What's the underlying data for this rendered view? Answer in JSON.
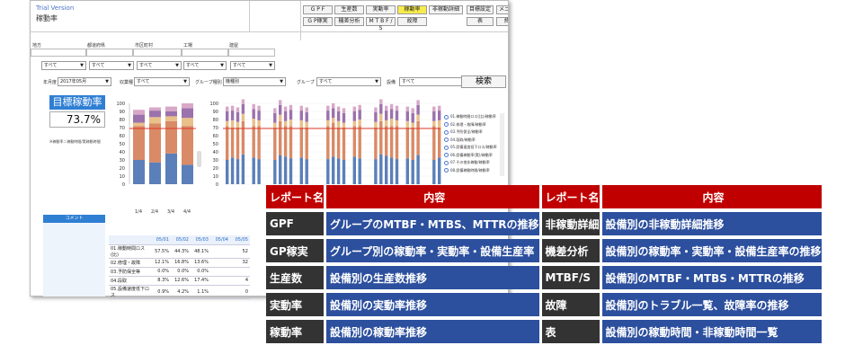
{
  "app": {
    "trial": "Trial Version",
    "title": "稼動率",
    "toolbar": {
      "row1": [
        "G P F",
        "生産数",
        "実動率",
        "稼動率",
        "非稼動詳細",
        "目標設定",
        "メニュー"
      ],
      "row2": [
        "G P稼実",
        "機差分析",
        "M T B F / S",
        "故障",
        "表",
        "終了"
      ],
      "active": "稼動率"
    },
    "filters": {
      "labels": [
        "地方",
        "都道府県",
        "市区町村",
        "工場",
        "建屋"
      ],
      "selects": [
        "すべて",
        "すべて",
        "すべて",
        "すべて",
        "すべて"
      ]
    },
    "subfilters": {
      "period_label": "年月度",
      "period_value": "2017年05月",
      "industry_label": "収業種",
      "industry_value": "すべて",
      "group_type_label": "グループ種別",
      "group_type_value": "機種別",
      "group_label": "グループ",
      "group_value": "すべて",
      "equipment_label": "設備",
      "equipment_value": "すべて",
      "search": "検索"
    },
    "kpi": {
      "title": "目標稼動率",
      "value": "73.7%",
      "note": "※稼動率＝稼動時間/実稼動時間"
    },
    "comment": "コメント",
    "small_chart": {
      "y_ticks": [
        "100",
        "90",
        "80",
        "70",
        "60",
        "50",
        "40",
        "30",
        "20",
        "10",
        "0"
      ],
      "x_labels": [
        "1/4",
        "2/4",
        "3/4",
        "4/4"
      ]
    },
    "big_chart": {
      "y_ticks": [
        "100",
        "90",
        "80",
        "70",
        "60",
        "50",
        "40",
        "30",
        "20",
        "10",
        "0"
      ]
    },
    "legend_items": [
      "01.稼動時間ロス(比)/稼動率",
      "02.修理・故障/稼動率",
      "03.予防保全/稼動率",
      "04.段取/稼動率",
      "05.設備速度低下ロス/稼動率",
      "06.設備稼動率(実)/稼動率",
      "07.その他非稼動/稼動率",
      "08.設備稼動時間/稼動率"
    ],
    "data_table": {
      "headers": [
        "05/01",
        "05/02",
        "05/03",
        "05/04",
        "05/05"
      ],
      "rows": [
        {
          "label": "01.稼動時間ロス(比)",
          "values": [
            "57.5%",
            "44.3%",
            "48.1%",
            "",
            "52"
          ]
        },
        {
          "label": "02.修理・故障",
          "values": [
            "12.1%",
            "16.8%",
            "13.6%",
            "",
            "32"
          ]
        },
        {
          "label": "03.予防保全等",
          "values": [
            "0.0%",
            "0.0%",
            "0.0%",
            "",
            ""
          ]
        },
        {
          "label": "04.段取",
          "values": [
            "8.3%",
            "12.6%",
            "17.4%",
            "",
            "4"
          ]
        },
        {
          "label": "05.設備速度低下ロス",
          "values": [
            "0.9%",
            "4.2%",
            "1.1%",
            "",
            "0"
          ]
        }
      ]
    }
  },
  "report_table": {
    "headers": [
      "レポート名",
      "内容",
      "レポート名",
      "内容"
    ],
    "rows": [
      [
        "GPF",
        "グループのMTBF・MTBS、MTTRの推移",
        "非稼動詳細",
        "設備別の非稼動詳細推移"
      ],
      [
        "GP稼実",
        "グループ別の稼動率・実動率・設備生産率",
        "機差分析",
        "設備別の稼動率・実動率・設備生産率の推移"
      ],
      [
        "生産数",
        "設備別の生産数推移",
        "MTBF/S",
        "設備別のMTBF・MTBS・MTTRの推移"
      ],
      [
        "実動率",
        "設備別の実動率推移",
        "故障",
        "設備別のトラブル一覧、故障率の推移"
      ],
      [
        "稼動率",
        "設備別の稼動率推移",
        "表",
        "設備別の稼動時間・非稼動時間一覧"
      ]
    ]
  },
  "colors": {
    "blue": "#5b7fb8",
    "orange": "#d98a66",
    "tan": "#e9c08a",
    "purple": "#9b72ac",
    "pink": "#d8a8c8",
    "target_line": "#e03a2a",
    "table_dark": "#333333",
    "table_blue": "#2c4f9e",
    "table_red": "#c00000"
  }
}
